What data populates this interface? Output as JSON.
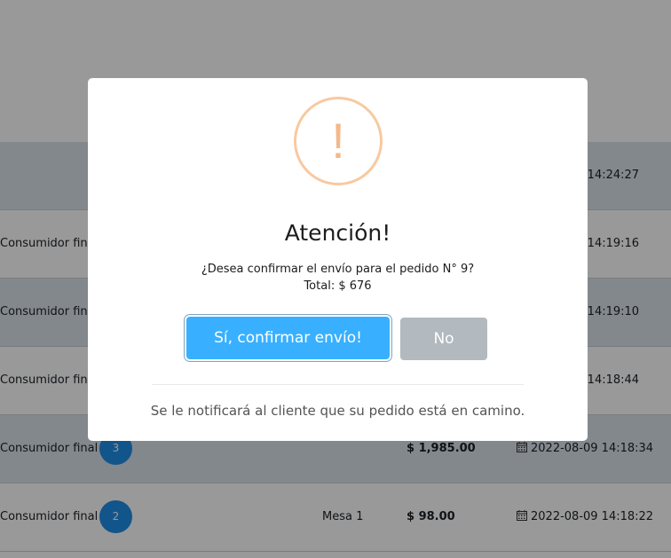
{
  "orders": [
    {
      "client": "",
      "num": "",
      "table": "",
      "total": "",
      "date": "2022-08-09 14:24:27"
    },
    {
      "client": "Consumidor final",
      "num": "",
      "table": "",
      "total": "",
      "date": "2022-08-09 14:19:16"
    },
    {
      "client": "Consumidor final",
      "num": "",
      "table": "",
      "total": "",
      "date": "2022-08-09 14:19:10"
    },
    {
      "client": "Consumidor final",
      "num": "",
      "table": "",
      "total": "",
      "date": "2022-08-09 14:18:44"
    },
    {
      "client": "Consumidor final",
      "num": "3",
      "table": "",
      "total": "$ 1,985.00",
      "date": "2022-08-09 14:18:34"
    },
    {
      "client": "Consumidor final",
      "num": "2",
      "table": "Mesa 1",
      "total": "$ 98.00",
      "date": "2022-08-09 14:18:22"
    }
  ],
  "dialog": {
    "icon": "warning-exclamation-icon",
    "icon_glyph": "!",
    "title": "Atención!",
    "message_line1": "¿Desea confirmar el envío para el pedido N° 9?",
    "message_line2": "Total: $ 676",
    "confirm_label": "Sí, confirmar envío!",
    "cancel_label": "No",
    "footer": "Se le notificará al cliente que su pedido está en camino."
  },
  "colors": {
    "confirm": "#38b0ff",
    "cancel": "#b2b9bf",
    "warning": "#f8c9a0",
    "badge": "#1f8ee8"
  }
}
